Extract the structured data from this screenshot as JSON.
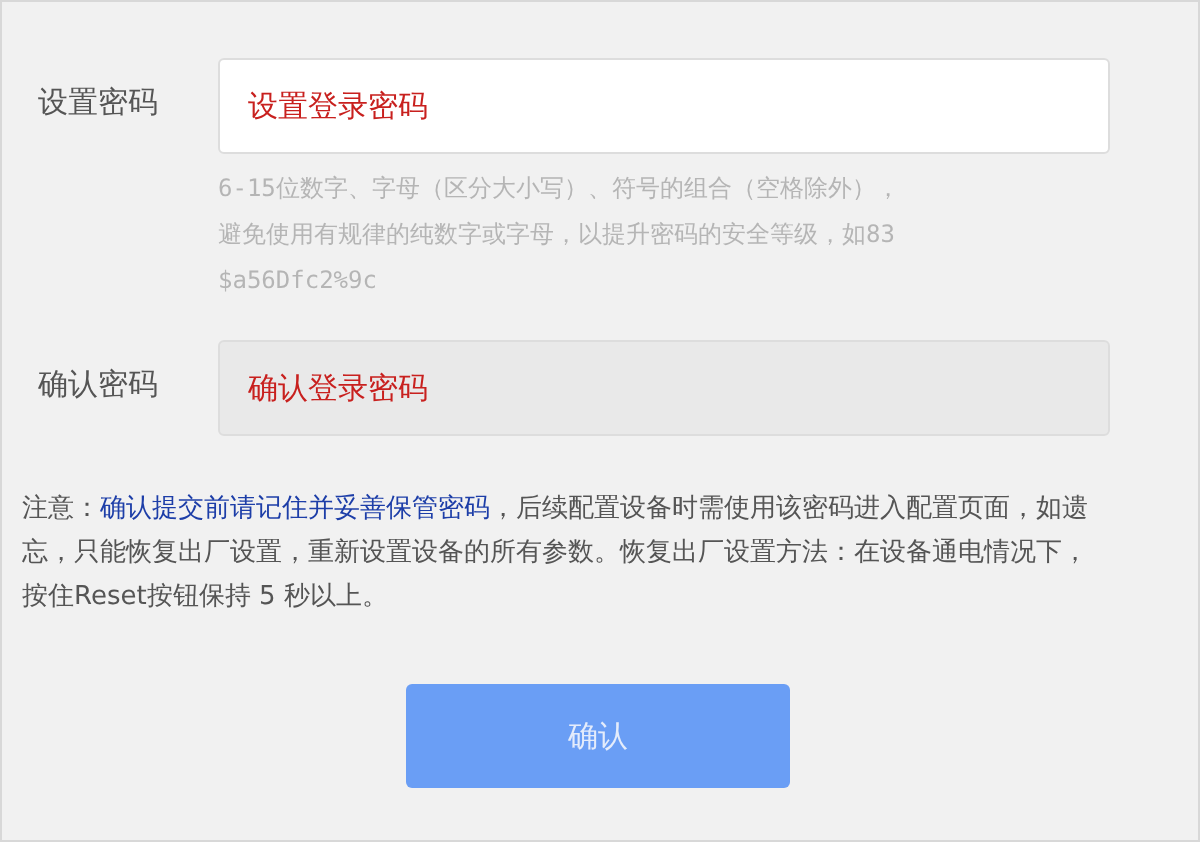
{
  "fields": [
    {
      "label": "设置密码",
      "placeholder": "设置登录密码",
      "disabled": false,
      "hint": [
        "6-15位数字、字母（区分大小写）、符号的组合（空格除外），",
        "避免使用有规律的纯数字或字母，以提升密码的安全等级，如83",
        "$a56Dfc2%9c"
      ]
    },
    {
      "label": "确认密码",
      "placeholder": "确认登录密码",
      "disabled": true
    }
  ],
  "note": [
    {
      "kind": "plain",
      "text": "注意："
    },
    {
      "kind": "emphasis",
      "text": "确认提交前请记住并妥善保管密码"
    },
    {
      "kind": "plain",
      "text": "，后续配置设备时需使用该密码进入配置页面，如遗忘，只能恢复出厂设置，重新设置设备的所有参数。恢复出厂设置方法：在设备通电情况下，按住Reset按钮保持 5 秒以上。"
    }
  ],
  "button": {
    "label": "确认",
    "disabled": true
  }
}
